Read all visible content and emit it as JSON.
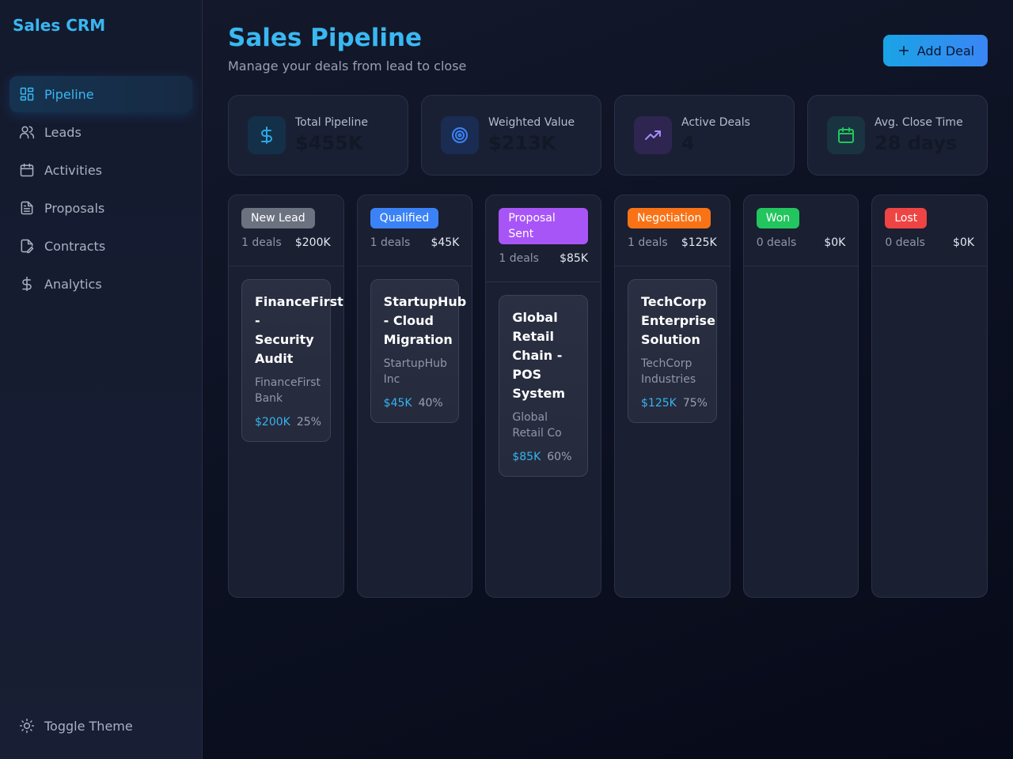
{
  "app": {
    "brand": "Sales CRM"
  },
  "sidebar": {
    "items": [
      {
        "label": "Pipeline",
        "icon": "dashboard-icon",
        "active": true
      },
      {
        "label": "Leads",
        "icon": "users-icon",
        "active": false
      },
      {
        "label": "Activities",
        "icon": "calendar-icon",
        "active": false
      },
      {
        "label": "Proposals",
        "icon": "document-icon",
        "active": false
      },
      {
        "label": "Contracts",
        "icon": "file-edit-icon",
        "active": false
      },
      {
        "label": "Analytics",
        "icon": "dollar-icon",
        "active": false
      }
    ],
    "toggle_label": "Toggle Theme"
  },
  "header": {
    "title": "Sales Pipeline",
    "subtitle": "Manage your deals from lead to close",
    "add_label": "Add Deal"
  },
  "stats": [
    {
      "label": "Total Pipeline",
      "value": "$455K",
      "icon": "dollar-icon",
      "color": "#2aa8e6"
    },
    {
      "label": "Weighted Value",
      "value": "$213K",
      "icon": "target-icon",
      "color": "#3b82f6"
    },
    {
      "label": "Active Deals",
      "value": "4",
      "icon": "trending-up-icon",
      "color": "#a78bfa"
    },
    {
      "label": "Avg. Close Time",
      "value": "28 days",
      "icon": "calendar-icon",
      "color": "#22c55e"
    }
  ],
  "columns": [
    {
      "label": "New Lead",
      "color": "#6b7280",
      "count": "1 deals",
      "total": "$200K",
      "cards": [
        {
          "title": "FinanceFirst - Security Audit",
          "company": "FinanceFirst Bank",
          "value": "$200K",
          "probability": "25%"
        }
      ]
    },
    {
      "label": "Qualified",
      "color": "#3b82f6",
      "count": "1 deals",
      "total": "$45K",
      "cards": [
        {
          "title": "StartupHub - Cloud Migration",
          "company": "StartupHub Inc",
          "value": "$45K",
          "probability": "40%"
        }
      ]
    },
    {
      "label": "Proposal Sent",
      "color": "#a855f7",
      "count": "1 deals",
      "total": "$85K",
      "cards": [
        {
          "title": "Global Retail Chain - POS System",
          "company": "Global Retail Co",
          "value": "$85K",
          "probability": "60%"
        }
      ]
    },
    {
      "label": "Negotiation",
      "color": "#f97316",
      "count": "1 deals",
      "total": "$125K",
      "cards": [
        {
          "title": "TechCorp Enterprise Solution",
          "company": "TechCorp Industries",
          "value": "$125K",
          "probability": "75%"
        }
      ]
    },
    {
      "label": "Won",
      "color": "#22c55e",
      "count": "0 deals",
      "total": "$0K",
      "cards": []
    },
    {
      "label": "Lost",
      "color": "#ef4444",
      "count": "0 deals",
      "total": "$0K",
      "cards": []
    }
  ]
}
